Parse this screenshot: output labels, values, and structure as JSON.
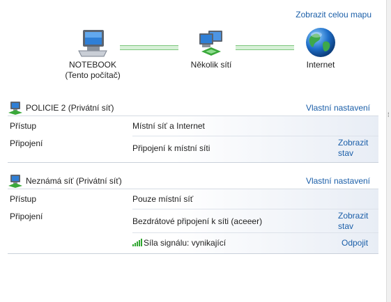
{
  "header": {
    "map_link": "Zobrazit celou mapu"
  },
  "map": {
    "computer": {
      "name": "NOTEBOOK",
      "sub": "(Tento počítač)"
    },
    "middle": {
      "name": "Několik sítí"
    },
    "internet": {
      "name": "Internet"
    }
  },
  "networks": [
    {
      "name": "POLICIE  2 (Privátní síť)",
      "customize": "Vlastní nastavení",
      "access_label": "Přístup",
      "access_value": "Místní síť a Internet",
      "connections_label": "Připojení",
      "connection_value": "Připojení k místní síti",
      "status_link_1": "Zobrazit",
      "status_link_2": "stav"
    },
    {
      "name": "Neznámá síť (Privátní síť)",
      "customize": "Vlastní nastavení",
      "access_label": "Přístup",
      "access_value": "Pouze místní síť",
      "connections_label": "Připojení",
      "connection_value": "Bezdrátové připojení k síti (aceeer)",
      "status_link_1": "Zobrazit",
      "status_link_2": "stav",
      "signal_label": "Síla signálu: vynikající",
      "disconnect": "Odpojit"
    }
  ],
  "colors": {
    "link": "#1a5ea8",
    "connector": "#7cc67c",
    "signal": "#2fa52f"
  },
  "icons": [
    "computer-icon",
    "multiple-networks-icon",
    "globe-icon",
    "network-icon",
    "signal-bars-icon"
  ]
}
